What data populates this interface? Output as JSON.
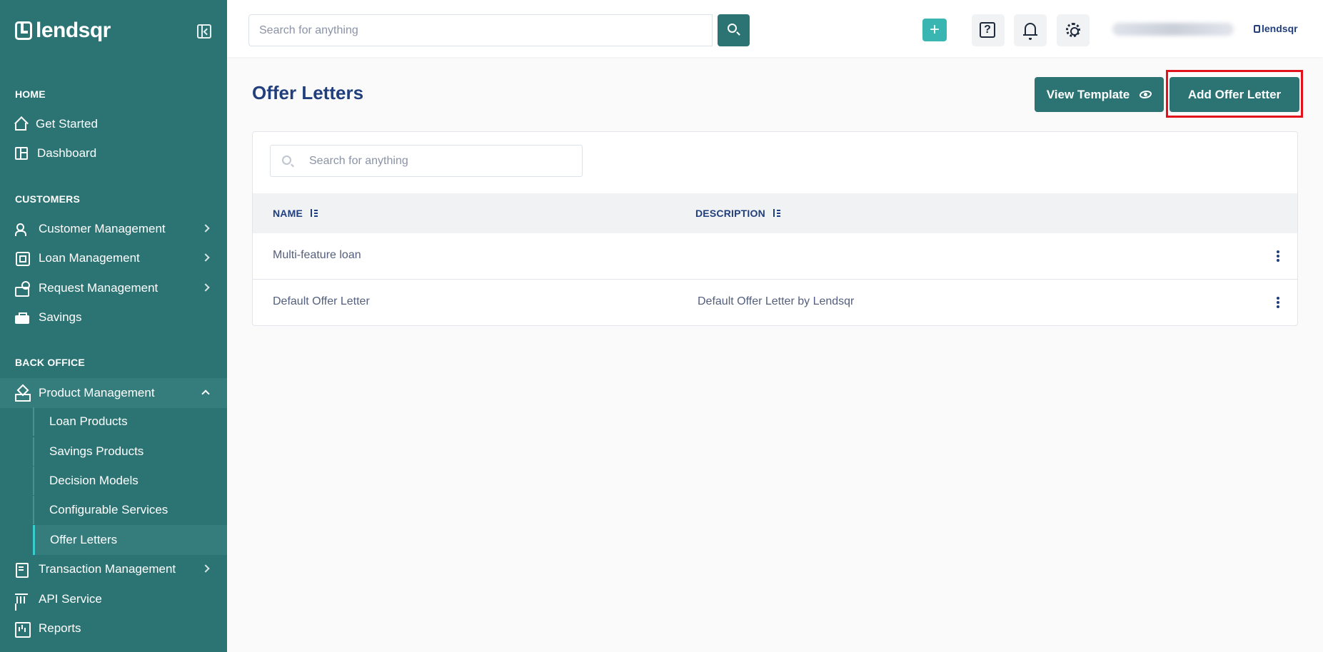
{
  "app": {
    "brand": "lendsqr"
  },
  "topbar": {
    "search_placeholder": "Search for anything",
    "plus_label": "+",
    "help_label": "?",
    "brand_small": "lendsqr"
  },
  "sidebar": {
    "sections": {
      "home": "HOME",
      "customers": "CUSTOMERS",
      "back_office": "BACK OFFICE"
    },
    "items": [
      {
        "label": "Get Started",
        "icon": "home-icon"
      },
      {
        "label": "Dashboard",
        "icon": "dashboard-icon"
      },
      {
        "label": "Customer Management",
        "icon": "users-icon"
      },
      {
        "label": "Loan Management",
        "icon": "loan-icon"
      },
      {
        "label": "Request Management",
        "icon": "hand-icon"
      },
      {
        "label": "Savings",
        "icon": "briefcase-icon"
      },
      {
        "label": "Product Management",
        "icon": "shapes-icon"
      },
      {
        "label": "Transaction Management",
        "icon": "receipt-icon"
      },
      {
        "label": "API Service",
        "icon": "bank-icon"
      },
      {
        "label": "Reports",
        "icon": "chart-icon"
      }
    ],
    "sub_items": [
      {
        "label": "Loan Products"
      },
      {
        "label": "Savings Products"
      },
      {
        "label": "Decision Models"
      },
      {
        "label": "Configurable Services"
      },
      {
        "label": "Offer Letters"
      }
    ]
  },
  "main": {
    "title": "Offer Letters",
    "view_template_label": "View Template",
    "add_label": "Add Offer Letter",
    "search_placeholder": "Search for anything",
    "columns": [
      "NAME",
      "DESCRIPTION"
    ],
    "rows": [
      {
        "name": "Multi-feature loan",
        "description": ""
      },
      {
        "name": "Default Offer Letter",
        "description": "Default Offer Letter by Lendsqr"
      }
    ]
  },
  "colors": {
    "sidebar_bg": "#2c7474",
    "accent": "#39cdcc",
    "highlight": "#e1121b",
    "title": "#213f7d"
  }
}
